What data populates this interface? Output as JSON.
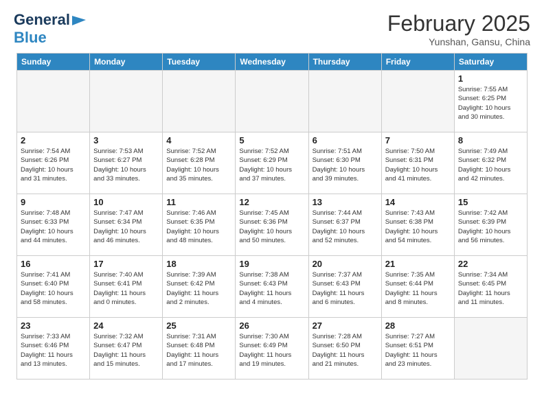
{
  "header": {
    "logo_general": "General",
    "logo_blue": "Blue",
    "month_title": "February 2025",
    "location": "Yunshan, Gansu, China"
  },
  "days_of_week": [
    "Sunday",
    "Monday",
    "Tuesday",
    "Wednesday",
    "Thursday",
    "Friday",
    "Saturday"
  ],
  "weeks": [
    {
      "cells": [
        {
          "empty": true
        },
        {
          "empty": true
        },
        {
          "empty": true
        },
        {
          "empty": true
        },
        {
          "empty": true
        },
        {
          "empty": true
        },
        {
          "day": 1,
          "info": "Sunrise: 7:55 AM\nSunset: 6:25 PM\nDaylight: 10 hours\nand 30 minutes."
        }
      ]
    },
    {
      "cells": [
        {
          "day": 2,
          "info": "Sunrise: 7:54 AM\nSunset: 6:26 PM\nDaylight: 10 hours\nand 31 minutes."
        },
        {
          "day": 3,
          "info": "Sunrise: 7:53 AM\nSunset: 6:27 PM\nDaylight: 10 hours\nand 33 minutes."
        },
        {
          "day": 4,
          "info": "Sunrise: 7:52 AM\nSunset: 6:28 PM\nDaylight: 10 hours\nand 35 minutes."
        },
        {
          "day": 5,
          "info": "Sunrise: 7:52 AM\nSunset: 6:29 PM\nDaylight: 10 hours\nand 37 minutes."
        },
        {
          "day": 6,
          "info": "Sunrise: 7:51 AM\nSunset: 6:30 PM\nDaylight: 10 hours\nand 39 minutes."
        },
        {
          "day": 7,
          "info": "Sunrise: 7:50 AM\nSunset: 6:31 PM\nDaylight: 10 hours\nand 41 minutes."
        },
        {
          "day": 8,
          "info": "Sunrise: 7:49 AM\nSunset: 6:32 PM\nDaylight: 10 hours\nand 42 minutes."
        }
      ]
    },
    {
      "cells": [
        {
          "day": 9,
          "info": "Sunrise: 7:48 AM\nSunset: 6:33 PM\nDaylight: 10 hours\nand 44 minutes."
        },
        {
          "day": 10,
          "info": "Sunrise: 7:47 AM\nSunset: 6:34 PM\nDaylight: 10 hours\nand 46 minutes."
        },
        {
          "day": 11,
          "info": "Sunrise: 7:46 AM\nSunset: 6:35 PM\nDaylight: 10 hours\nand 48 minutes."
        },
        {
          "day": 12,
          "info": "Sunrise: 7:45 AM\nSunset: 6:36 PM\nDaylight: 10 hours\nand 50 minutes."
        },
        {
          "day": 13,
          "info": "Sunrise: 7:44 AM\nSunset: 6:37 PM\nDaylight: 10 hours\nand 52 minutes."
        },
        {
          "day": 14,
          "info": "Sunrise: 7:43 AM\nSunset: 6:38 PM\nDaylight: 10 hours\nand 54 minutes."
        },
        {
          "day": 15,
          "info": "Sunrise: 7:42 AM\nSunset: 6:39 PM\nDaylight: 10 hours\nand 56 minutes."
        }
      ]
    },
    {
      "cells": [
        {
          "day": 16,
          "info": "Sunrise: 7:41 AM\nSunset: 6:40 PM\nDaylight: 10 hours\nand 58 minutes."
        },
        {
          "day": 17,
          "info": "Sunrise: 7:40 AM\nSunset: 6:41 PM\nDaylight: 11 hours\nand 0 minutes."
        },
        {
          "day": 18,
          "info": "Sunrise: 7:39 AM\nSunset: 6:42 PM\nDaylight: 11 hours\nand 2 minutes."
        },
        {
          "day": 19,
          "info": "Sunrise: 7:38 AM\nSunset: 6:43 PM\nDaylight: 11 hours\nand 4 minutes."
        },
        {
          "day": 20,
          "info": "Sunrise: 7:37 AM\nSunset: 6:43 PM\nDaylight: 11 hours\nand 6 minutes."
        },
        {
          "day": 21,
          "info": "Sunrise: 7:35 AM\nSunset: 6:44 PM\nDaylight: 11 hours\nand 8 minutes."
        },
        {
          "day": 22,
          "info": "Sunrise: 7:34 AM\nSunset: 6:45 PM\nDaylight: 11 hours\nand 11 minutes."
        }
      ]
    },
    {
      "cells": [
        {
          "day": 23,
          "info": "Sunrise: 7:33 AM\nSunset: 6:46 PM\nDaylight: 11 hours\nand 13 minutes."
        },
        {
          "day": 24,
          "info": "Sunrise: 7:32 AM\nSunset: 6:47 PM\nDaylight: 11 hours\nand 15 minutes."
        },
        {
          "day": 25,
          "info": "Sunrise: 7:31 AM\nSunset: 6:48 PM\nDaylight: 11 hours\nand 17 minutes."
        },
        {
          "day": 26,
          "info": "Sunrise: 7:30 AM\nSunset: 6:49 PM\nDaylight: 11 hours\nand 19 minutes."
        },
        {
          "day": 27,
          "info": "Sunrise: 7:28 AM\nSunset: 6:50 PM\nDaylight: 11 hours\nand 21 minutes."
        },
        {
          "day": 28,
          "info": "Sunrise: 7:27 AM\nSunset: 6:51 PM\nDaylight: 11 hours\nand 23 minutes."
        },
        {
          "empty": true
        }
      ]
    }
  ]
}
